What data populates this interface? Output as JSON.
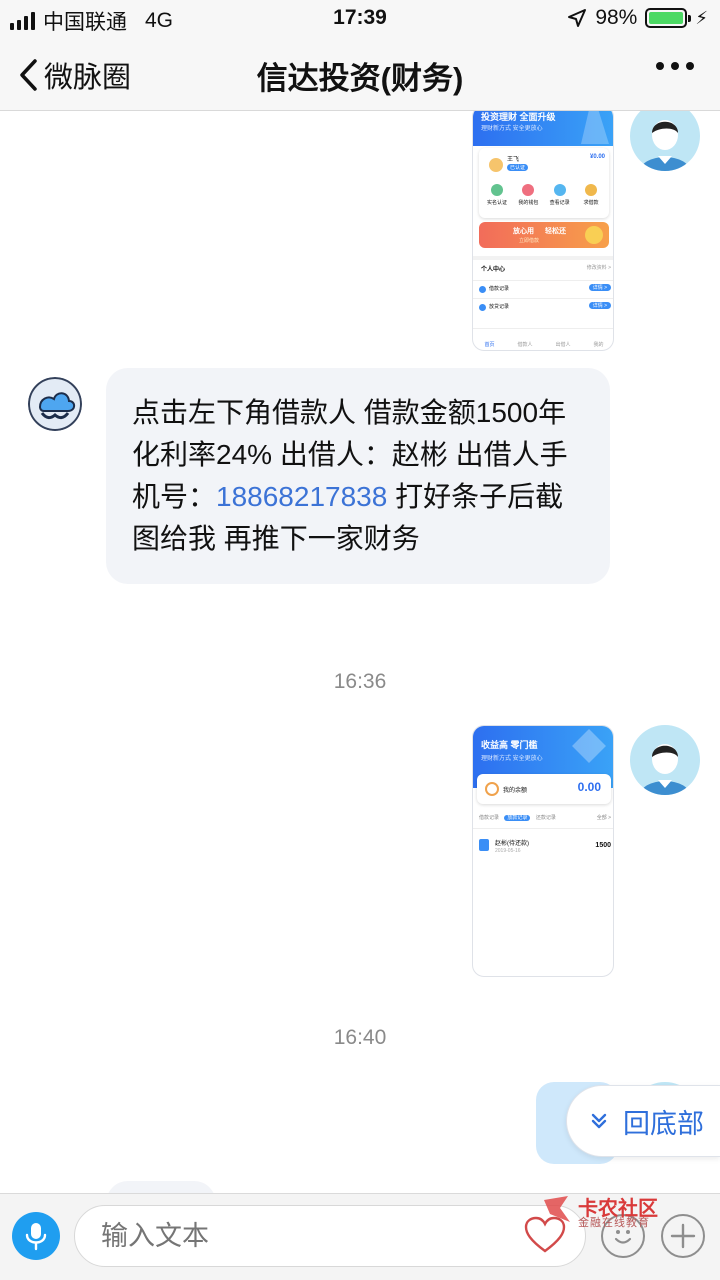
{
  "status_bar": {
    "carrier": "中国联通",
    "network": "4G",
    "time": "17:39",
    "battery": "98%",
    "battery_level": 0.98
  },
  "nav": {
    "back_label": "微脉圈",
    "title": "信达投资(财务)"
  },
  "messages": {
    "screenshot1": {
      "banner_title": "投资理财 全面升级",
      "banner_sub": "理财新方式 安全更放心",
      "user_name": "王飞",
      "badge": "已认证",
      "balance": "¥0.00",
      "grid": [
        "实名认证",
        "我的钱包",
        "查看记录",
        "求借款"
      ],
      "promo_1": "放心用",
      "promo_2": "轻松还",
      "promo_sub": "立即借款",
      "section_title": "个人中心",
      "section_link": "修改资料 >",
      "rows": [
        {
          "label": "借款记录",
          "action": "详情 >"
        },
        {
          "label": "放贷记录",
          "action": "详情 >"
        }
      ],
      "tabs": [
        "首页",
        "借款人",
        "出借人",
        "我的"
      ]
    },
    "text_message": {
      "part1": "点击左下角借款人   借款金额1500年化利率24%   出借人：赵彬     出借人手机号：",
      "phone": "18868217838",
      "part2": "     打好条子后截图给我    再推下一家财务"
    },
    "timestamp1": "16:36",
    "screenshot2": {
      "banner_title": "收益高 零门槛",
      "banner_sub": "理财新方式 安全更放心",
      "balance_label": "我的余额",
      "balance": "0.00",
      "tabs": [
        "借款记录",
        "放款记录",
        "还款记录"
      ],
      "more": "全部 >",
      "record_name": "赵彬(待还款)",
      "record_date": "2019-05-16",
      "record_amount": "1500"
    },
    "timestamp2": "16:40"
  },
  "scroll_to_bottom": "回底部",
  "input": {
    "placeholder": "输入文本"
  },
  "watermark": {
    "title": "卡农社区",
    "subtitle": "金融在线教育"
  }
}
